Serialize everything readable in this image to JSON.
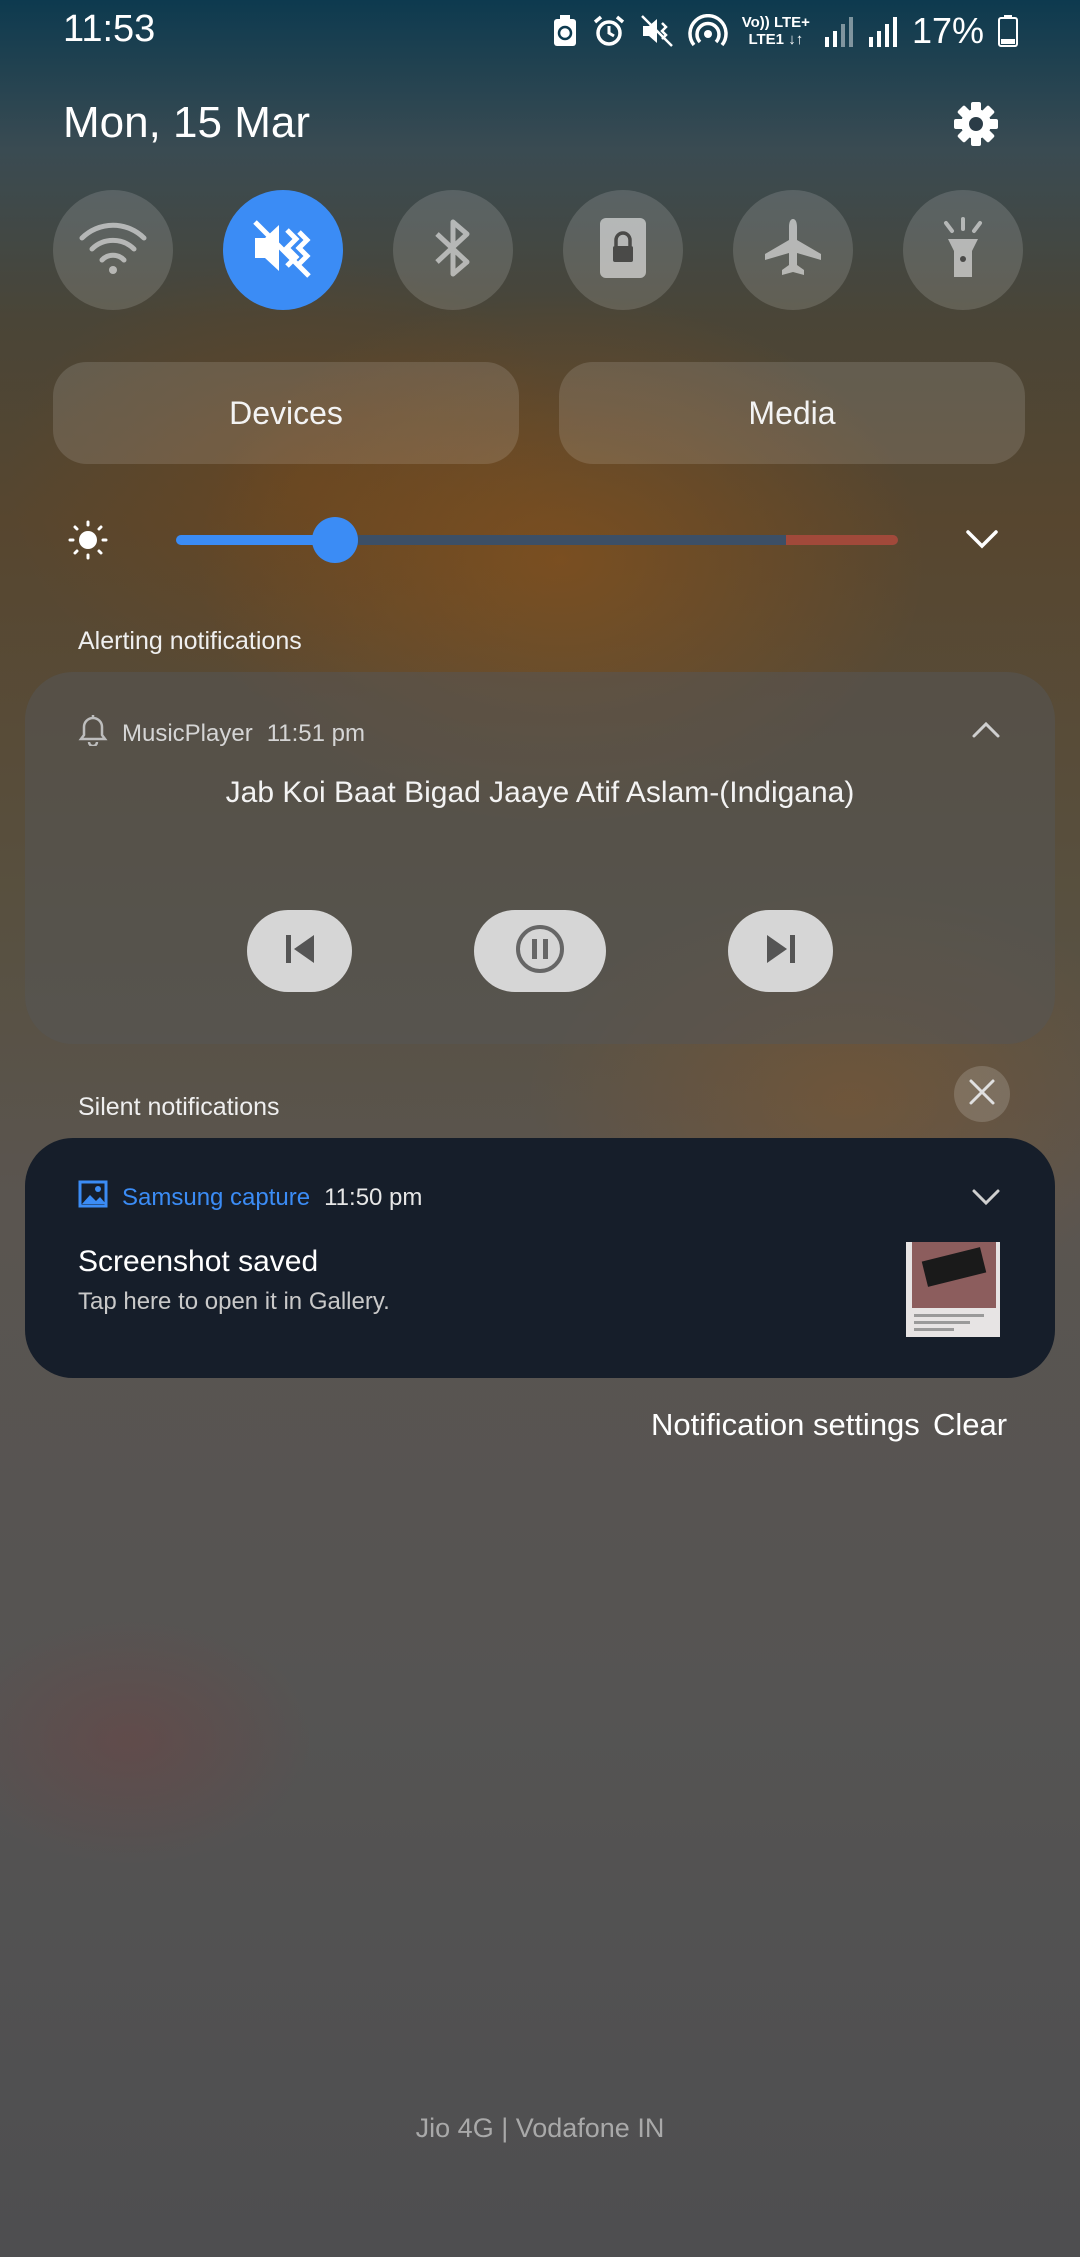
{
  "status_bar": {
    "time": "11:53",
    "lte_top": "Vo)) LTE+",
    "lte_bottom": "LTE1 ↓↑",
    "battery": "17%"
  },
  "header": {
    "date": "Mon, 15 Mar"
  },
  "quick_toggles": [
    {
      "name": "wifi-icon",
      "active": false
    },
    {
      "name": "mute-icon",
      "active": true
    },
    {
      "name": "bluetooth-icon",
      "active": false
    },
    {
      "name": "lock-icon",
      "active": false
    },
    {
      "name": "airplane-icon",
      "active": false
    },
    {
      "name": "flashlight-icon",
      "active": false
    }
  ],
  "panels": {
    "devices_label": "Devices",
    "media_label": "Media"
  },
  "brightness": {
    "level": 0.22
  },
  "alerting": {
    "label": "Alerting notifications",
    "app": "MusicPlayer",
    "time": "11:51 pm",
    "song": "Jab Koi Baat Bigad Jaaye Atif Aslam-(Indigana)"
  },
  "silent": {
    "label": "Silent notifications",
    "app": "Samsung capture",
    "time": "11:50 pm",
    "title": "Screenshot saved",
    "subtitle": "Tap here to open it in Gallery."
  },
  "actions": {
    "settings_label": "Notification settings",
    "clear_label": "Clear"
  },
  "carrier": "Jio 4G | Vodafone IN",
  "colors": {
    "accent": "#3b8cf5",
    "card_dark": "#161e2a"
  }
}
